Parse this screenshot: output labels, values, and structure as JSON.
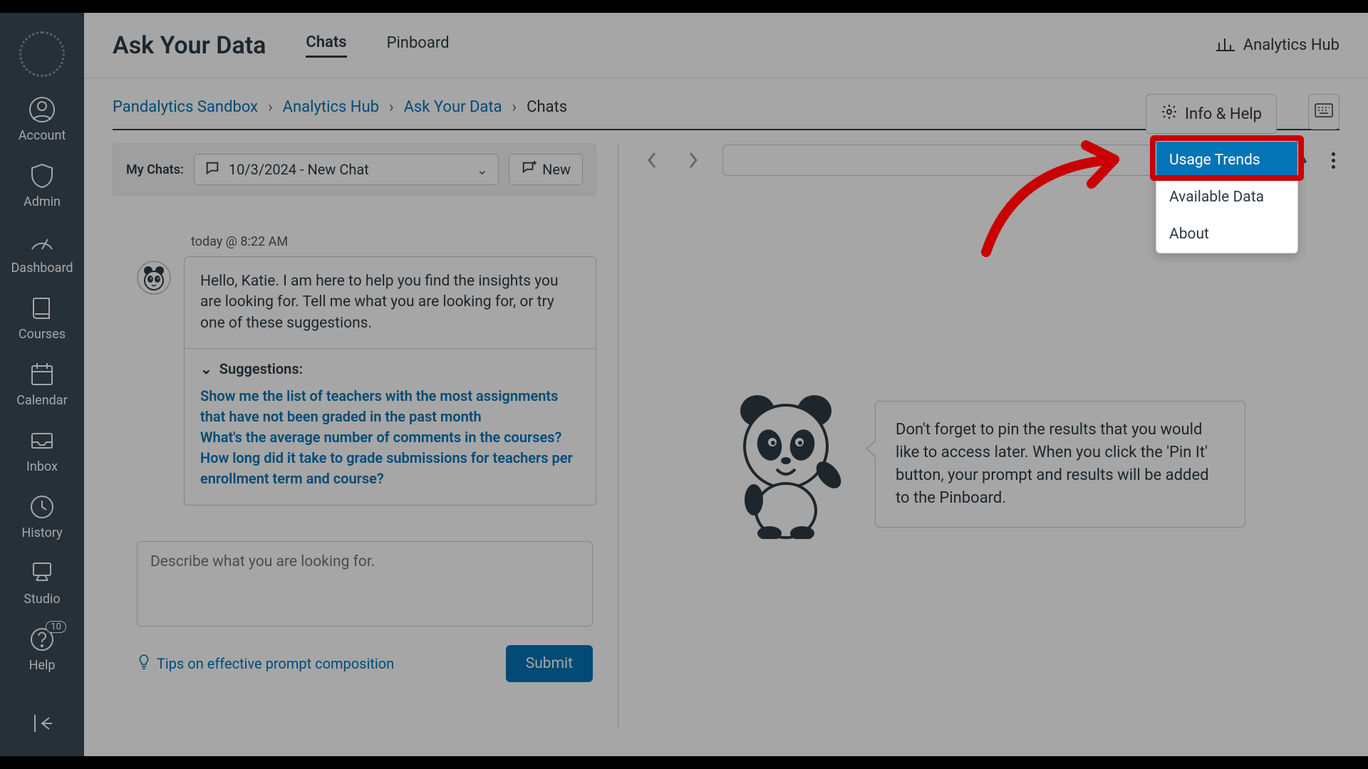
{
  "sidebar": {
    "items": [
      {
        "label": "Account"
      },
      {
        "label": "Admin"
      },
      {
        "label": "Dashboard"
      },
      {
        "label": "Courses"
      },
      {
        "label": "Calendar"
      },
      {
        "label": "Inbox"
      },
      {
        "label": "History"
      },
      {
        "label": "Studio"
      },
      {
        "label": "Help"
      }
    ],
    "help_badge": "10"
  },
  "header": {
    "title": "Ask Your Data",
    "tabs": [
      {
        "label": "Chats"
      },
      {
        "label": "Pinboard"
      }
    ],
    "hub_label": "Analytics Hub"
  },
  "crumbs": {
    "a": "Pandalytics Sandbox",
    "b": "Analytics Hub",
    "c": "Ask Your Data",
    "d": "Chats"
  },
  "info_help": "Info & Help",
  "chat_toolbar": {
    "label": "My Chats:",
    "selected": "10/3/2024 - New Chat",
    "new_btn": "New"
  },
  "message": {
    "time": "today @ 8:22 AM",
    "text": "Hello, Katie. I am here to help you find the insights you are looking for. Tell me what you are looking for, or try one of these suggestions.",
    "sugg_title": "Suggestions:",
    "suggestions": [
      "Show me the list of teachers with the most assignments that have not been graded in the past month",
      "What's the average number of comments in the courses?",
      "How long did it take to grade submissions for teachers per enrollment term and course?"
    ]
  },
  "input": {
    "placeholder": "Describe what you are looking for.",
    "tips": "Tips on effective prompt composition",
    "submit": "Submit"
  },
  "panda_tip": "Don't forget to pin the results that you would like to access later. When you click the 'Pin It' button, your prompt and results will be added to the Pinboard.",
  "menu": {
    "a": "Usage Trends",
    "b": "Available Data",
    "c": "About"
  }
}
